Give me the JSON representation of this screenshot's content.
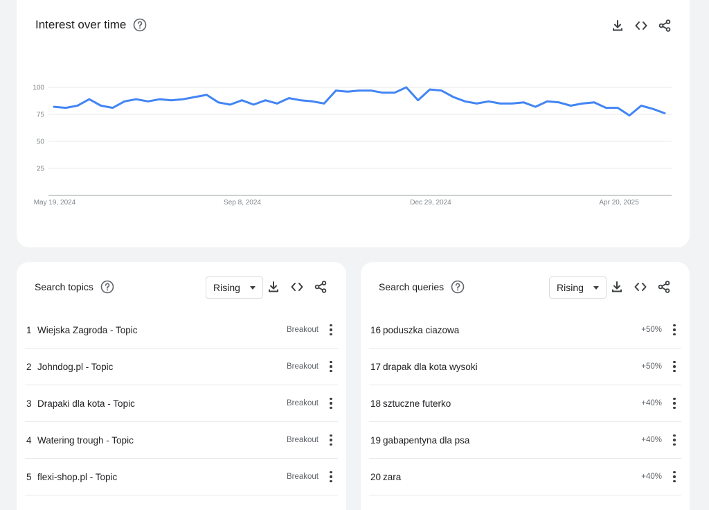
{
  "interest": {
    "title": "Interest over time",
    "help_icon": "help-circle-icon",
    "tools": [
      "download-icon",
      "embed-code-icon",
      "share-icon"
    ]
  },
  "chart_data": {
    "type": "line",
    "title": "Interest over time",
    "ylim": [
      0,
      100
    ],
    "yticks": [
      "25",
      "50",
      "75",
      "100"
    ],
    "xticks": [
      "May 19, 2024",
      "Sep 8, 2024",
      "Dec 29, 2024",
      "Apr 20, 2025"
    ],
    "grid": true,
    "line_color": "#4285f4",
    "series": [
      {
        "values": [
          82,
          81,
          83,
          89,
          83,
          81,
          87,
          89,
          87,
          89,
          88,
          89,
          91,
          93,
          86,
          84,
          88,
          84,
          88,
          85,
          90,
          88,
          87,
          85,
          97,
          96,
          97,
          97,
          95,
          95,
          100,
          88,
          98,
          97,
          91,
          87,
          85,
          87,
          85,
          85,
          86,
          82,
          87,
          86,
          83,
          85,
          86,
          81,
          81,
          74,
          83,
          80,
          76
        ]
      }
    ]
  },
  "topics": {
    "title": "Search topics",
    "dropdown": "Rising",
    "items": [
      {
        "num": "1",
        "label": "Wiejska Zagroda - Topic",
        "value": "Breakout"
      },
      {
        "num": "2",
        "label": "Johndog.pl - Topic",
        "value": "Breakout"
      },
      {
        "num": "3",
        "label": "Drapaki dla kota - Topic",
        "value": "Breakout"
      },
      {
        "num": "4",
        "label": "Watering trough - Topic",
        "value": "Breakout"
      },
      {
        "num": "5",
        "label": "flexi-shop.pl - Topic",
        "value": "Breakout"
      }
    ]
  },
  "queries": {
    "title": "Search queries",
    "dropdown": "Rising",
    "items": [
      {
        "num": "16",
        "label": "poduszka ciazowa",
        "value": "+50%"
      },
      {
        "num": "17",
        "label": "drapak dla kota wysoki",
        "value": "+50%"
      },
      {
        "num": "18",
        "label": "sztuczne futerko",
        "value": "+40%"
      },
      {
        "num": "19",
        "label": "gabapentyna dla psa",
        "value": "+40%"
      },
      {
        "num": "20",
        "label": "zara",
        "value": "+40%"
      }
    ]
  }
}
